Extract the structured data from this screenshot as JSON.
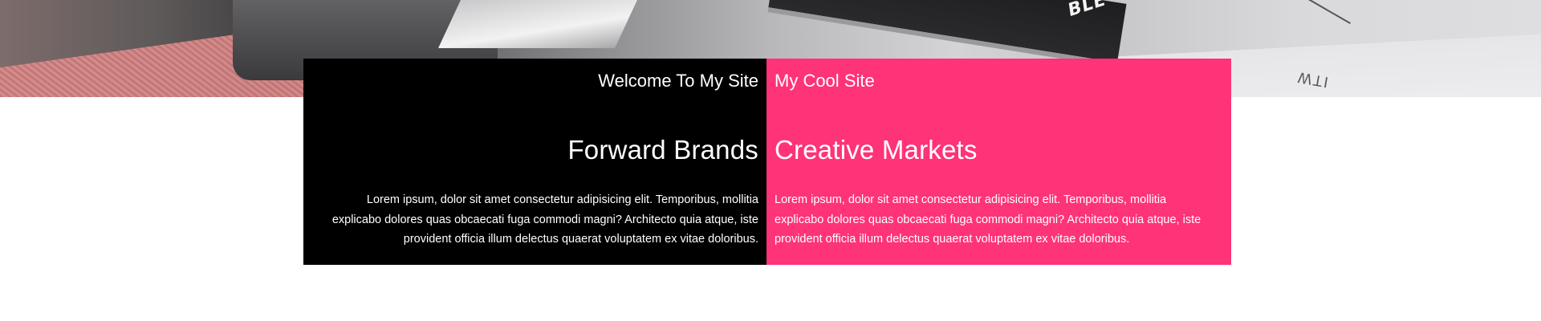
{
  "hero": {
    "image_alt": "black and white photo of devices on a desk with pink strap",
    "box_text": "BLE",
    "paper_text": "ITW"
  },
  "panels": {
    "left": {
      "background": "#000000",
      "site_title": "Welcome To My Site",
      "headline": "Forward Brands",
      "body": "Lorem ipsum, dolor sit amet consectetur adipisicing elit. Temporibus, mollitia explicabo dolores quas obcaecati fuga commodi magni? Architecto quia atque, iste provident officia illum delectus quaerat voluptatem ex vitae doloribus."
    },
    "right": {
      "background": "#ff3377",
      "site_title": "My Cool Site",
      "headline": "Creative Markets",
      "body": "Lorem ipsum, dolor sit amet consectetur adipisicing elit. Temporibus, mollitia explicabo dolores quas obcaecati fuga commodi magni? Architecto quia atque, iste provident officia illum delectus quaerat voluptatem ex vitae doloribus."
    }
  }
}
